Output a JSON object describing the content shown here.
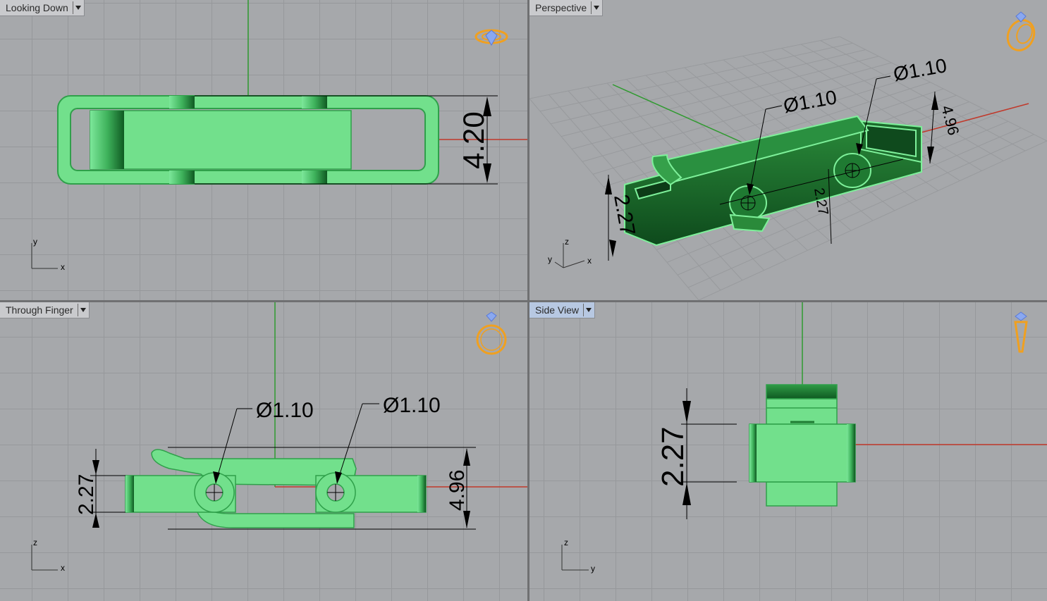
{
  "viewports": [
    {
      "id": "top",
      "label": "Looking Down",
      "active": false
    },
    {
      "id": "perspective",
      "label": "Perspective",
      "active": false
    },
    {
      "id": "front",
      "label": "Through Finger",
      "active": false
    },
    {
      "id": "side",
      "label": "Side View",
      "active": true
    }
  ],
  "dimensions": {
    "top_width": "4.20",
    "persp_dia_1": "Ø1.10",
    "persp_dia_2": "Ø1.10",
    "persp_height": "2.27",
    "persp_width": "4.96",
    "persp_mid": "2.27",
    "front_dia_1": "Ø1.10",
    "front_dia_2": "Ø1.10",
    "front_height": "2.27",
    "front_width": "4.96",
    "side_height": "2.27"
  },
  "axes": {
    "top": [
      "x",
      "y"
    ],
    "perspective": [
      "x",
      "y",
      "z"
    ],
    "front": [
      "x",
      "z"
    ],
    "side": [
      "y",
      "z"
    ]
  },
  "colors": {
    "model": "#72e08c",
    "model_edge": "#1f8a3a",
    "axis_x": "#c0392b",
    "axis_y": "#2f9a2f",
    "ring_icon": "#f0a020",
    "gem_icon": "#5a7ad8"
  },
  "icons": {
    "top": "ring-top-view-icon",
    "perspective": "ring-perspective-icon",
    "front": "ring-front-view-icon",
    "side": "ring-side-view-icon"
  }
}
